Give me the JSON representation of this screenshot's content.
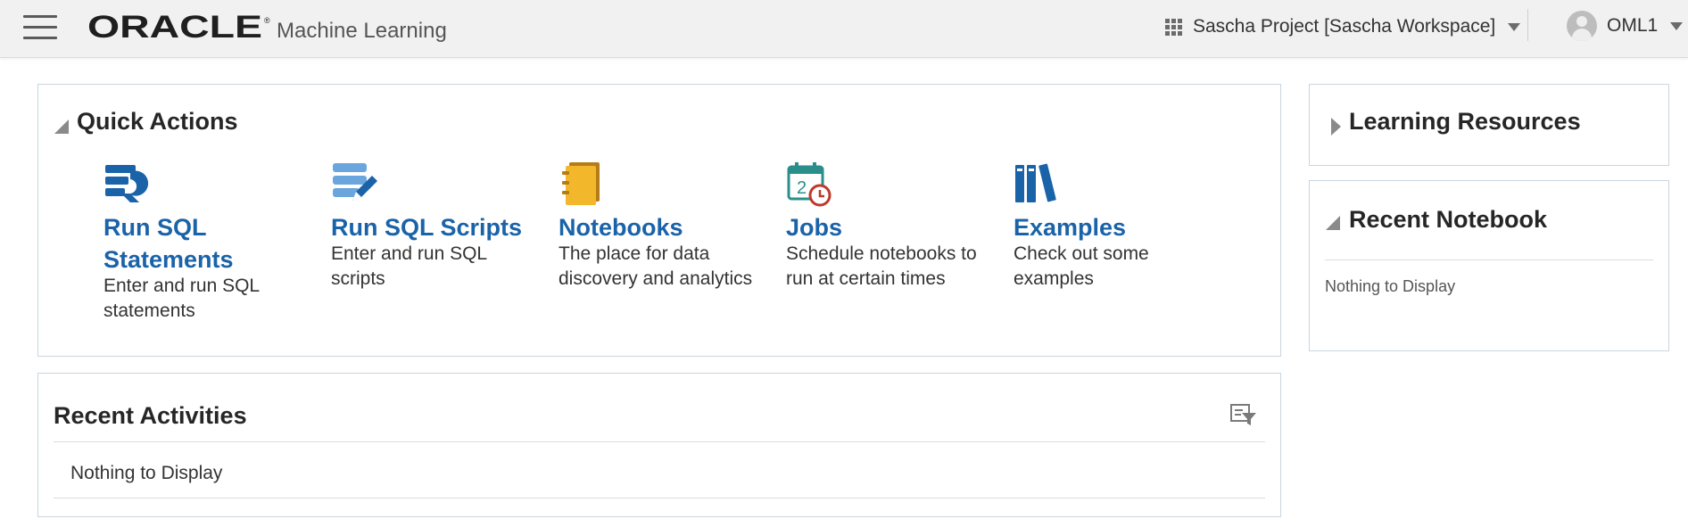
{
  "header": {
    "brand": "ORACLE",
    "product": "Machine Learning",
    "project": "Sascha Project [Sascha Workspace]",
    "user": "OML1"
  },
  "quick_actions": {
    "title": "Quick Actions",
    "items": [
      {
        "title_line1": "Run SQL",
        "title_line2": "Statements",
        "desc": "Enter and run SQL statements",
        "icon": "sql-statements-icon"
      },
      {
        "title": "Run SQL Scripts",
        "desc": "Enter and run SQL scripts",
        "icon": "sql-scripts-icon"
      },
      {
        "title": "Notebooks",
        "desc": "The place for data discovery and analytics",
        "icon": "notebook-icon"
      },
      {
        "title": "Jobs",
        "desc": "Schedule notebooks to run at certain times",
        "icon": "jobs-calendar-icon"
      },
      {
        "title": "Examples",
        "desc": "Check out some examples",
        "icon": "books-icon"
      }
    ]
  },
  "recent_activities": {
    "title": "Recent Activities",
    "empty": "Nothing to Display"
  },
  "learning_resources": {
    "title": "Learning Resources"
  },
  "recent_notebook": {
    "title": "Recent Notebook",
    "empty": "Nothing to Display"
  },
  "colors": {
    "accent": "#1a63a8",
    "header_bg": "#f1f1f1",
    "panel_border": "#c9d6e0"
  }
}
